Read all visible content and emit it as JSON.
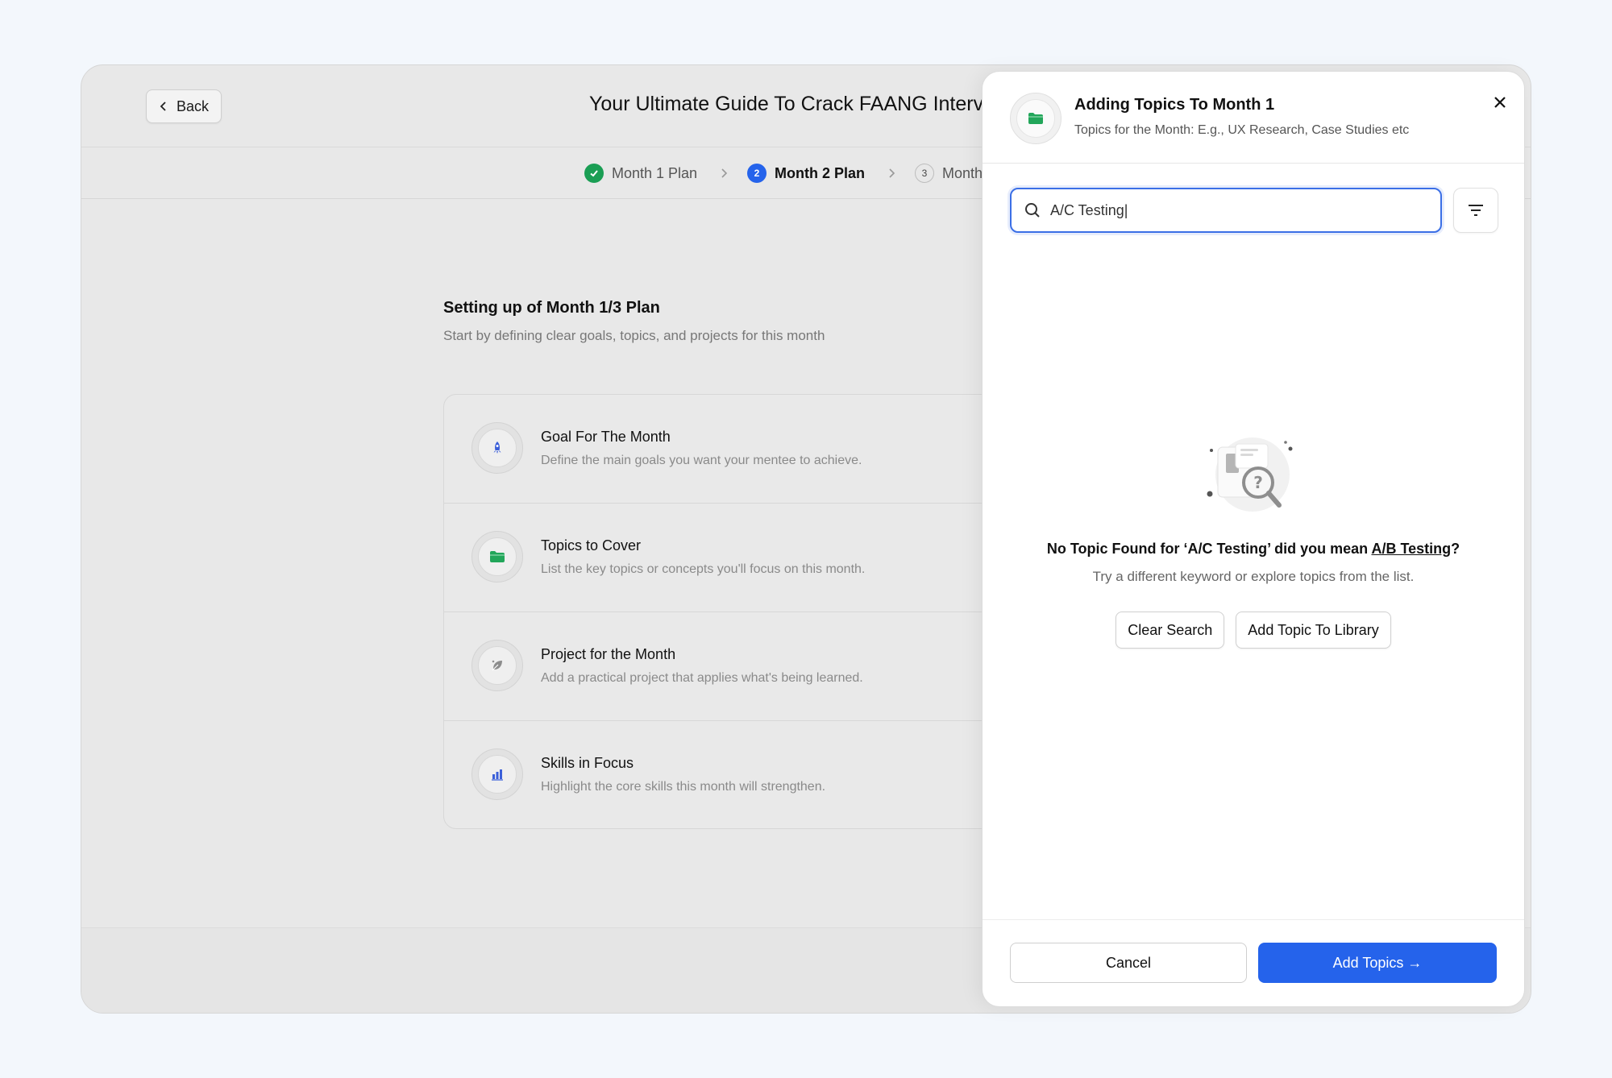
{
  "header": {
    "back_label": "Back",
    "title": "Your Ultimate Guide To Crack FAANG Interv"
  },
  "stepper": {
    "steps": [
      {
        "label": "Month 1 Plan",
        "state": "done",
        "number": ""
      },
      {
        "label": "Month 2 Plan",
        "state": "active",
        "number": "2"
      },
      {
        "label": "Month",
        "state": "pending",
        "number": "3"
      }
    ]
  },
  "main": {
    "title": "Setting up of Month 1/3 Plan",
    "subtitle": "Start by defining clear goals, topics, and projects for this month",
    "cards": [
      {
        "title": "Goal For The Month",
        "description": "Define the main goals you want your mentee to achieve.",
        "icon": "rocket-icon"
      },
      {
        "title": "Topics to Cover",
        "description": "List the key topics or concepts you'll focus on this month.",
        "icon": "folder-icon"
      },
      {
        "title": "Project for the Month",
        "description": "Add a practical project that applies what's being learned.",
        "icon": "leaf-icon"
      },
      {
        "title": "Skills in Focus",
        "description": "Highlight the core skills this month will strengthen.",
        "icon": "bar-chart-icon"
      }
    ]
  },
  "panel": {
    "title": "Adding Topics To Month 1",
    "subtitle": "Topics for the Month: E.g., UX Research, Case Studies etc",
    "search_value": "A/C Testing|",
    "empty_prefix": "No Topic Found for ‘A/C Testing’ did you mean ",
    "empty_suggestion": "A/B Testing",
    "empty_suffix": "?",
    "empty_sub": "Try a different keyword or explore topics from the list.",
    "clear_search_label": "Clear Search",
    "add_library_label": "Add Topic To Library",
    "cancel_label": "Cancel",
    "add_topics_label": "Add Topics →"
  },
  "colors": {
    "accent": "#2563eb",
    "success": "#1a9e54",
    "folder_green": "#22a65a"
  }
}
